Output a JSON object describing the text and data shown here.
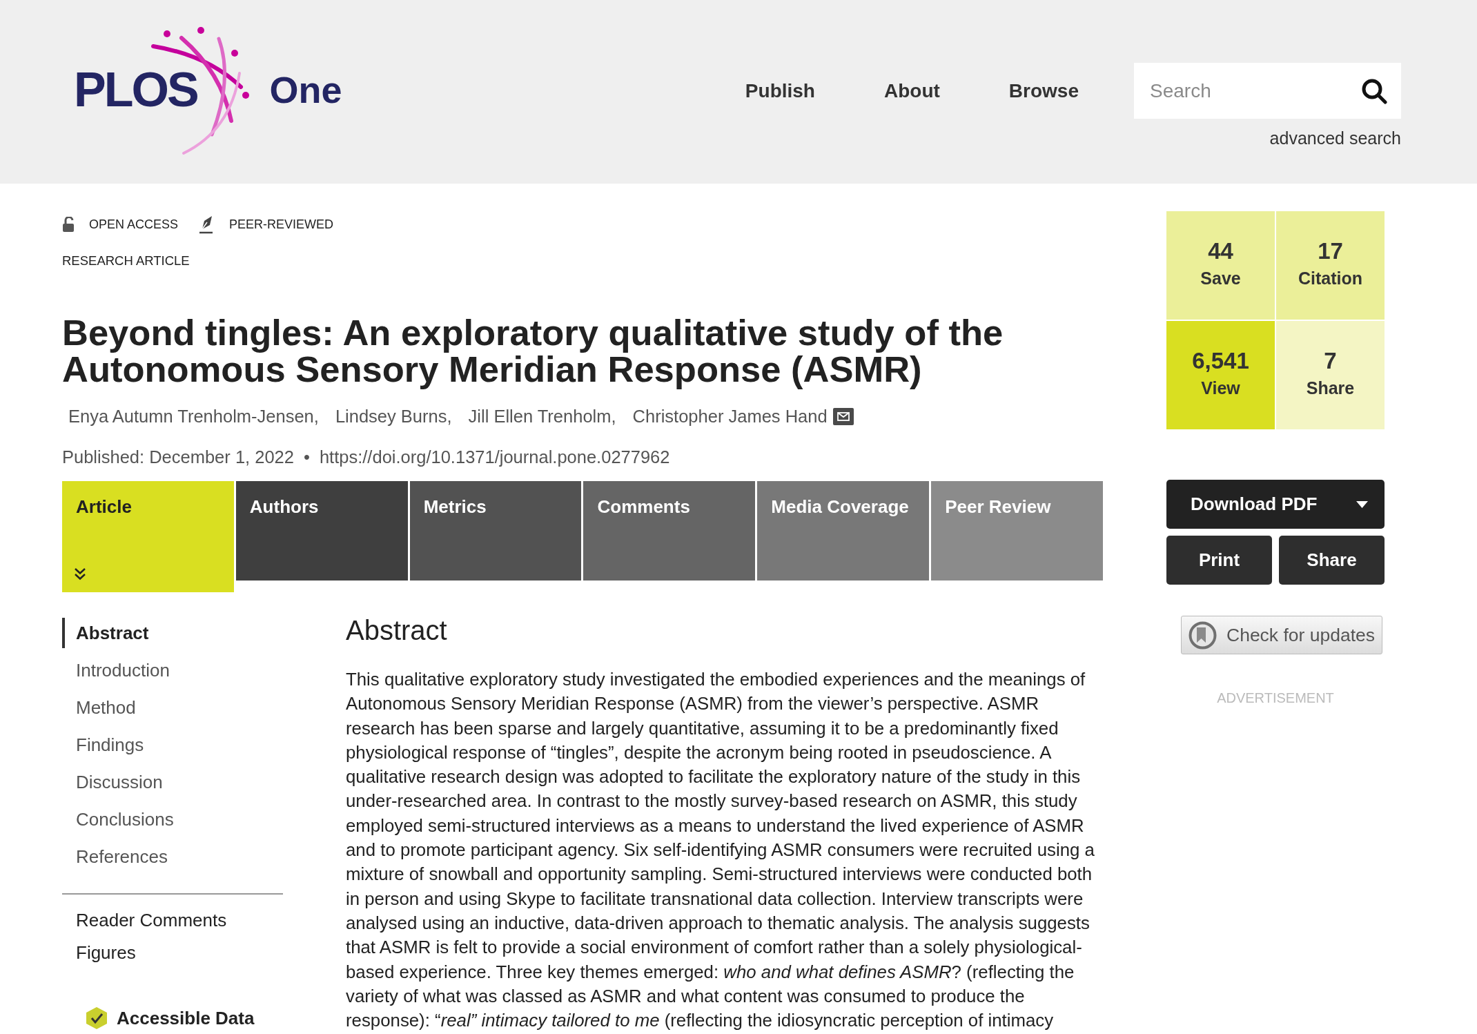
{
  "header": {
    "logo": {
      "wordmark": "PLOS",
      "suffix": "One"
    },
    "nav": [
      "Publish",
      "About",
      "Browse"
    ],
    "search": {
      "placeholder": "Search"
    },
    "advanced_search": "advanced search"
  },
  "article": {
    "badges": [
      {
        "kind": "open-access",
        "label": "OPEN ACCESS"
      },
      {
        "kind": "peer-reviewed",
        "label": "PEER-REVIEWED"
      }
    ],
    "type": "RESEARCH ARTICLE",
    "title": "Beyond tingles: An exploratory qualitative study of the Autonomous Sensory Meridian Response (ASMR)",
    "authors": [
      {
        "name": "Enya Autumn Trenholm-Jensen,",
        "corresponding": false
      },
      {
        "name": "Lindsey Burns,",
        "corresponding": false
      },
      {
        "name": "Jill Ellen Trenholm,",
        "corresponding": false
      },
      {
        "name": "Christopher James Hand",
        "corresponding": true
      }
    ],
    "published": "Published: December 1, 2022",
    "separator": "•",
    "doi": "https://doi.org/10.1371/journal.pone.0277962"
  },
  "tabs": [
    {
      "label": "Article",
      "selected": true
    },
    {
      "label": "Authors",
      "selected": false
    },
    {
      "label": "Metrics",
      "selected": false
    },
    {
      "label": "Comments",
      "selected": false
    },
    {
      "label": "Media Coverage",
      "selected": false
    },
    {
      "label": "Peer Review",
      "selected": false
    }
  ],
  "sidebar": {
    "sections": [
      {
        "label": "Abstract",
        "selected": true
      },
      {
        "label": "Introduction",
        "selected": false
      },
      {
        "label": "Method",
        "selected": false
      },
      {
        "label": "Findings",
        "selected": false
      },
      {
        "label": "Discussion",
        "selected": false
      },
      {
        "label": "Conclusions",
        "selected": false
      },
      {
        "label": "References",
        "selected": false
      }
    ],
    "links": [
      "Reader Comments",
      "Figures"
    ],
    "accessible_data": "Accessible Data"
  },
  "abstract": {
    "heading": "Abstract",
    "text": "This qualitative exploratory study investigated the embodied experiences and the meanings of Autonomous Sensory Meridian Response (ASMR) from the viewer’s perspective. ASMR research has been sparse and largely quantitative, assuming it to be a predominantly fixed physiological response of “tingles”, despite the acronym being rooted in pseudoscience. A qualitative research design was adopted to facilitate the exploratory nature of the study in this under-researched area. In contrast to the mostly survey-based research on ASMR, this study employed semi-structured interviews as a means to understand the lived experience of ASMR and to promote participant agency. Six self-identifying ASMR consumers were recruited using a mixture of snowball and opportunity sampling. Semi-structured interviews were conducted both in person and using Skype to facilitate transnational data collection. Interview transcripts were analysed using an inductive, data-driven approach to thematic analysis. The analysis suggests that ASMR is felt to provide a social environment of comfort rather than a solely physiological-based experience. Three key themes emerged: *who and what defines ASMR*? (reflecting the variety of what was classed as ASMR and what content was consumed to produce the response): “*real” intimacy tailored to me* (reflecting the idiosyncratic perception of intimacy"
  },
  "metrics": [
    {
      "value": "44",
      "label": "Save",
      "color": "#ebef99"
    },
    {
      "value": "17",
      "label": "Citation",
      "color": "#ebef99"
    },
    {
      "value": "6,541",
      "label": "View",
      "color": "#d9df21"
    },
    {
      "value": "7",
      "label": "Share",
      "color": "#f4f5c4"
    }
  ],
  "actions": {
    "download": "Download PDF",
    "buttons": [
      "Print",
      "Share"
    ],
    "check_updates": "Check for updates"
  },
  "advertisement": "ADVERTISEMENT"
}
